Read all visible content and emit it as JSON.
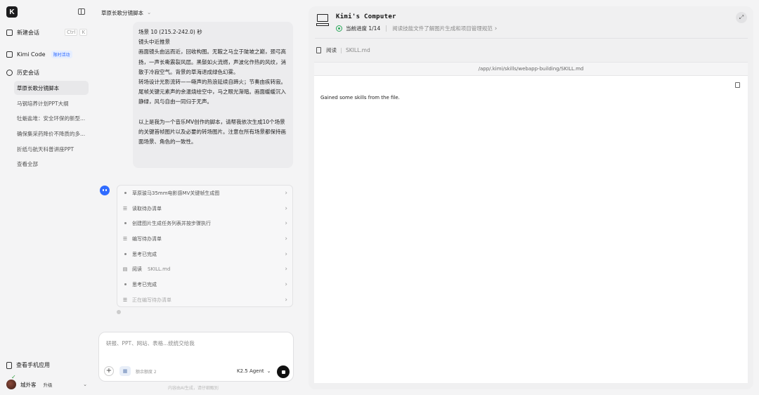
{
  "sidebar": {
    "logo": "K",
    "new_chat": "新建会话",
    "shortcut_keys": [
      "Ctrl",
      "K"
    ],
    "kimi_code": "Kimi Code",
    "kimi_code_badge": "限时活动",
    "history_title": "历史会话",
    "history_items": [
      "草原长歌分镜脚本",
      "马钢培养计划PPT大纲",
      "牡蛎盐堆：安全环保的新型...",
      "确保集采药降价不降质的多...",
      "折纸与航天科普讲座PPT",
      "查看全部"
    ],
    "phone_app": "查看手机应用",
    "username": "城外客",
    "upgrade": "升级"
  },
  "chat": {
    "title": "草原长歌分镜脚本",
    "user_message": [
      "场景 10 (215.2-242.0) 秒",
      "镜头中近推景",
      "画面镜头由远而近，回收构图。无鞍之马立于陡坡之巅，颈弓高扬，一声长嘶震裂风层。黑鬃如火流燃，声波化作热的风纹，消散于冷寂空气。背景的草海退成绿色幻雾。",
      "转场设计光影流转——嘶声的热浪延续自蹄火；节奏由疾转寂。",
      "尾帧关键元素声的余温烧绘空中，马之眼光渐暗。画面缓缓沉入静绿，风与自由一同归于无声。",
      "",
      "以上是我为一个音乐MV创作的脚本，请帮我依次生成10个场景的关键首帧图片以及必要的转场图片。注意在所有场景都保持画面场景、角色的一致性。"
    ],
    "steps": [
      {
        "icon": "dot",
        "label": "草原骏马35mm电影感MV关键帧生成图",
        "file": ""
      },
      {
        "icon": "list",
        "label": "读取待办清单",
        "file": ""
      },
      {
        "icon": "dot",
        "label": "创建图片生成任务列表并按步骤执行",
        "file": ""
      },
      {
        "icon": "list",
        "label": "编写待办清单",
        "file": ""
      },
      {
        "icon": "dot",
        "label": "思考已完成",
        "file": ""
      },
      {
        "icon": "doc",
        "label": "阅读",
        "file": "SKILL.md"
      },
      {
        "icon": "dot",
        "label": "思考已完成",
        "file": ""
      },
      {
        "icon": "list",
        "label": "正在编写待办清单",
        "file": ""
      }
    ],
    "input_placeholder": "研报、PPT、网站、表格...统统交给我",
    "skills_label": "额余额度 2",
    "model": "K2.5 Agent",
    "disclaimer": "内容由AI生成，请仔细甄别"
  },
  "computer": {
    "title": "Kimi's Computer",
    "progress_label": "当前进度 1/14",
    "progress_value": 0.0714,
    "progress_desc": "阅读技能文件了解图片生成和项目管理规范",
    "file_action": "阅读",
    "file_name": "SKILL.md",
    "path": "/app/.kimi/skills/webapp-building/SKILL.md",
    "content": "Gained some skills from the file."
  },
  "colors": {
    "accent_blue": "#2f6bff",
    "progress_green": "#2aa85a"
  }
}
